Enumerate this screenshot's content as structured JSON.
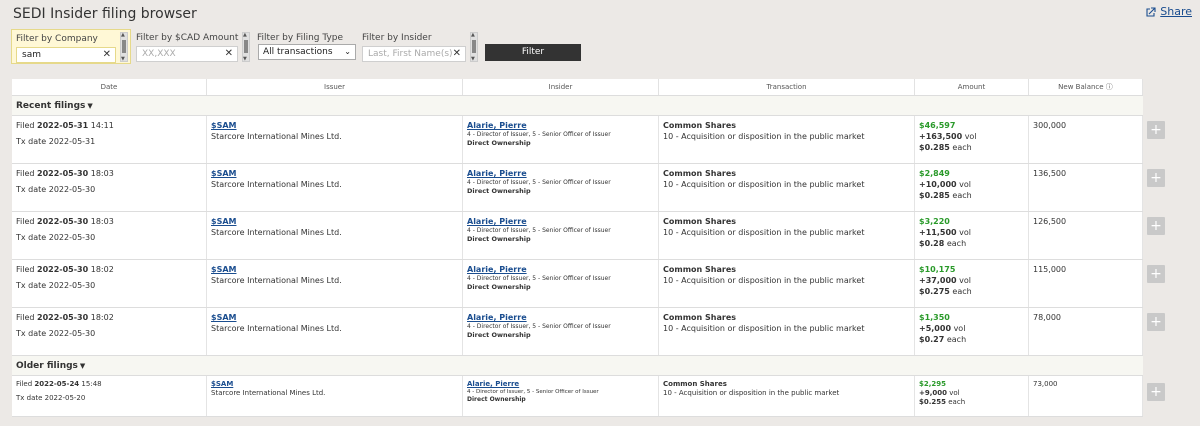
{
  "app": {
    "title": "SEDI Insider filing browser",
    "share_label": "Share"
  },
  "filters": {
    "company": {
      "label": "Filter by Company",
      "value": "sam"
    },
    "amount": {
      "label": "Filter by $CAD Amount",
      "placeholder": "XX,XXX"
    },
    "type": {
      "label": "Filter by Filing Type",
      "value": "All transactions"
    },
    "insider": {
      "label": "Filter by Insider",
      "placeholder": "Last, First Name(s)"
    },
    "button": "Filter"
  },
  "columns": [
    "Date",
    "Issuer",
    "Insider",
    "Transaction",
    "Amount",
    "New Balance ⓘ"
  ],
  "sections": {
    "recent": "Recent filings",
    "older": "Older filings"
  },
  "rows": [
    {
      "filed_label": "Filed",
      "filed_date": "2022-05-31",
      "filed_time": "14:11",
      "tx_date": "Tx date 2022-05-31",
      "ticker": "$SAM",
      "issuer": "Starcore International Mines Ltd.",
      "insider": "Alarie, Pierre",
      "role": "4 - Director of Issuer, 5 - Senior Officer of Issuer",
      "ownership": "Direct Ownership",
      "security": "Common Shares",
      "tx": "10 - Acquisition or disposition in the public market",
      "amount": "$46,597",
      "vol": "+163,500",
      "price": "$0.285",
      "balance": "300,000"
    },
    {
      "filed_label": "Filed",
      "filed_date": "2022-05-30",
      "filed_time": "18:03",
      "tx_date": "Tx date 2022-05-30",
      "ticker": "$SAM",
      "issuer": "Starcore International Mines Ltd.",
      "insider": "Alarie, Pierre",
      "role": "4 - Director of Issuer, 5 - Senior Officer of Issuer",
      "ownership": "Direct Ownership",
      "security": "Common Shares",
      "tx": "10 - Acquisition or disposition in the public market",
      "amount": "$2,849",
      "vol": "+10,000",
      "price": "$0.285",
      "balance": "136,500"
    },
    {
      "filed_label": "Filed",
      "filed_date": "2022-05-30",
      "filed_time": "18:03",
      "tx_date": "Tx date 2022-05-30",
      "ticker": "$SAM",
      "issuer": "Starcore International Mines Ltd.",
      "insider": "Alarie, Pierre",
      "role": "4 - Director of Issuer, 5 - Senior Officer of Issuer",
      "ownership": "Direct Ownership",
      "security": "Common Shares",
      "tx": "10 - Acquisition or disposition in the public market",
      "amount": "$3,220",
      "vol": "+11,500",
      "price": "$0.28",
      "balance": "126,500"
    },
    {
      "filed_label": "Filed",
      "filed_date": "2022-05-30",
      "filed_time": "18:02",
      "tx_date": "Tx date 2022-05-30",
      "ticker": "$SAM",
      "issuer": "Starcore International Mines Ltd.",
      "insider": "Alarie, Pierre",
      "role": "4 - Director of Issuer, 5 - Senior Officer of Issuer",
      "ownership": "Direct Ownership",
      "security": "Common Shares",
      "tx": "10 - Acquisition or disposition in the public market",
      "amount": "$10,175",
      "vol": "+37,000",
      "price": "$0.275",
      "balance": "115,000"
    },
    {
      "filed_label": "Filed",
      "filed_date": "2022-05-30",
      "filed_time": "18:02",
      "tx_date": "Tx date 2022-05-30",
      "ticker": "$SAM",
      "issuer": "Starcore International Mines Ltd.",
      "insider": "Alarie, Pierre",
      "role": "4 - Director of Issuer, 5 - Senior Officer of Issuer",
      "ownership": "Direct Ownership",
      "security": "Common Shares",
      "tx": "10 - Acquisition or disposition in the public market",
      "amount": "$1,350",
      "vol": "+5,000",
      "price": "$0.27",
      "balance": "78,000"
    }
  ],
  "older_rows": [
    {
      "filed_label": "Filed",
      "filed_date": "2022-05-24",
      "filed_time": "15:48",
      "tx_date": "Tx date 2022-05-20",
      "ticker": "$SAM",
      "issuer": "Starcore International Mines Ltd.",
      "insider": "Alarie, Pierre",
      "role": "4 - Director of Issuer, 5 - Senior Officer of Issuer",
      "ownership": "Direct Ownership",
      "security": "Common Shares",
      "tx": "10 - Acquisition or disposition in the public market",
      "amount": "$2,295",
      "vol": "+9,000",
      "price": "$0.255",
      "balance": "73,000"
    }
  ],
  "units": {
    "vol": "vol",
    "each": "each"
  },
  "colors": {
    "amount": "#2a9a2a",
    "link": "#1a4d8f",
    "button": "#333333"
  },
  "icons": {
    "share": "share-icon",
    "plus": "plus-icon",
    "clear": "close-icon",
    "chevron": "chevron-down-icon",
    "info": "info-icon"
  }
}
